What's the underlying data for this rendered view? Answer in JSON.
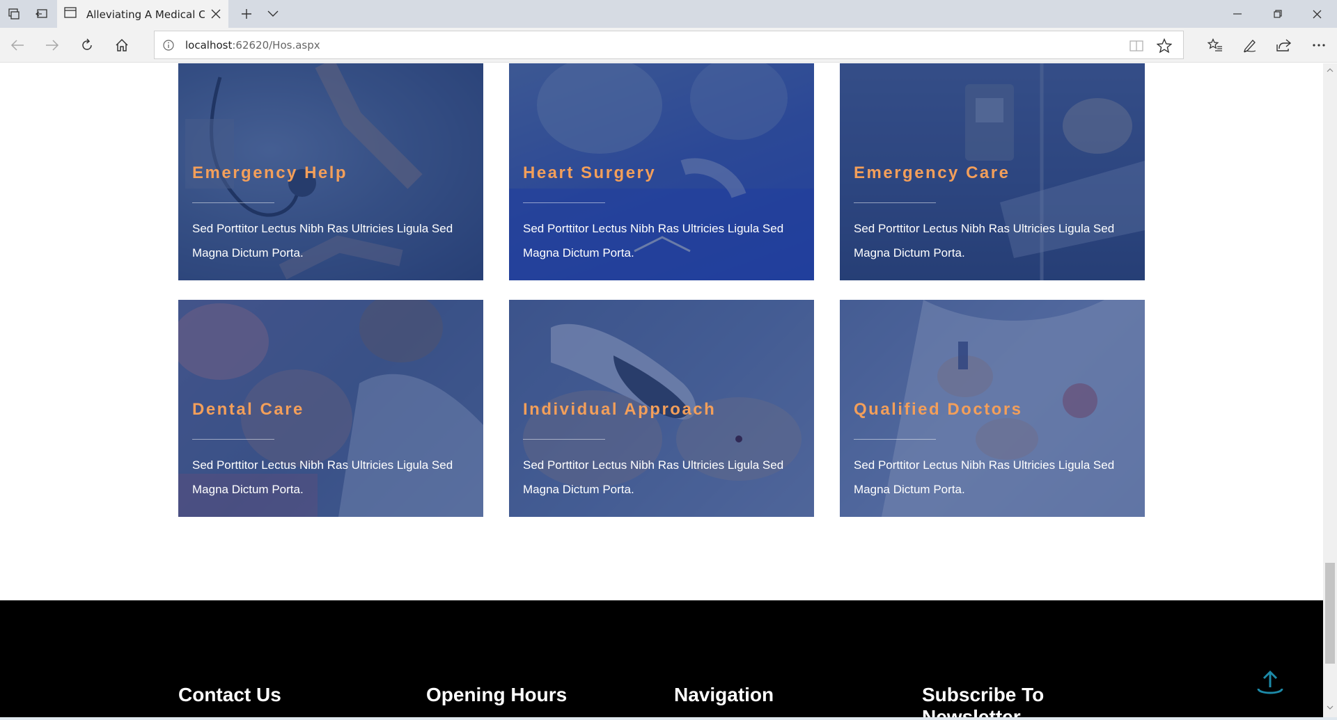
{
  "browser": {
    "tab_title": "Alleviating A Medical Ca",
    "url_host": "localhost",
    "url_rest": ":62620/Hos.aspx"
  },
  "cards": [
    {
      "title": "Emergency Help",
      "text": "Sed Porttitor Lectus Nibh Ras Ultricies Ligula Sed Magna Dictum Porta."
    },
    {
      "title": "Heart Surgery",
      "text": "Sed Porttitor Lectus Nibh Ras Ultricies Ligula Sed Magna Dictum Porta."
    },
    {
      "title": "Emergency Care",
      "text": "Sed Porttitor Lectus Nibh Ras Ultricies Ligula Sed Magna Dictum Porta."
    },
    {
      "title": "Dental Care",
      "text": "Sed Porttitor Lectus Nibh Ras Ultricies Ligula Sed Magna Dictum Porta."
    },
    {
      "title": "Individual Approach",
      "text": "Sed Porttitor Lectus Nibh Ras Ultricies Ligula Sed Magna Dictum Porta."
    },
    {
      "title": "Qualified Doctors",
      "text": "Sed Porttitor Lectus Nibh Ras Ultricies Ligula Sed Magna Dictum Porta."
    }
  ],
  "footer": {
    "contact_heading": "Contact Us",
    "hours_heading": "Opening Hours",
    "nav_heading": "Navigation",
    "subscribe_heading": "Subscribe To Newsletter"
  },
  "colors": {
    "card_title": "#f39f5a",
    "card_overlay": "#223e82",
    "footer_bg": "#000000",
    "to_top_icon": "#1d8aa8"
  },
  "icons": {
    "tab_actions": "tab-actions-icon",
    "tab_aside": "tabs-aside-icon",
    "page": "page-icon",
    "close": "close-icon",
    "new_tab": "plus-icon",
    "tab_list": "chevron-down-icon",
    "minimize": "minimize-icon",
    "restore": "restore-icon",
    "window_close": "close-icon",
    "back": "back-arrow-icon",
    "forward": "forward-arrow-icon",
    "refresh": "refresh-icon",
    "home": "home-icon",
    "info": "info-icon",
    "reading_view": "reading-view-icon",
    "favorite": "star-icon",
    "favorites_hub": "favorites-list-icon",
    "notes": "pen-icon",
    "share": "share-icon",
    "more": "more-icon",
    "scroll_top": "upload-arrow-icon"
  }
}
